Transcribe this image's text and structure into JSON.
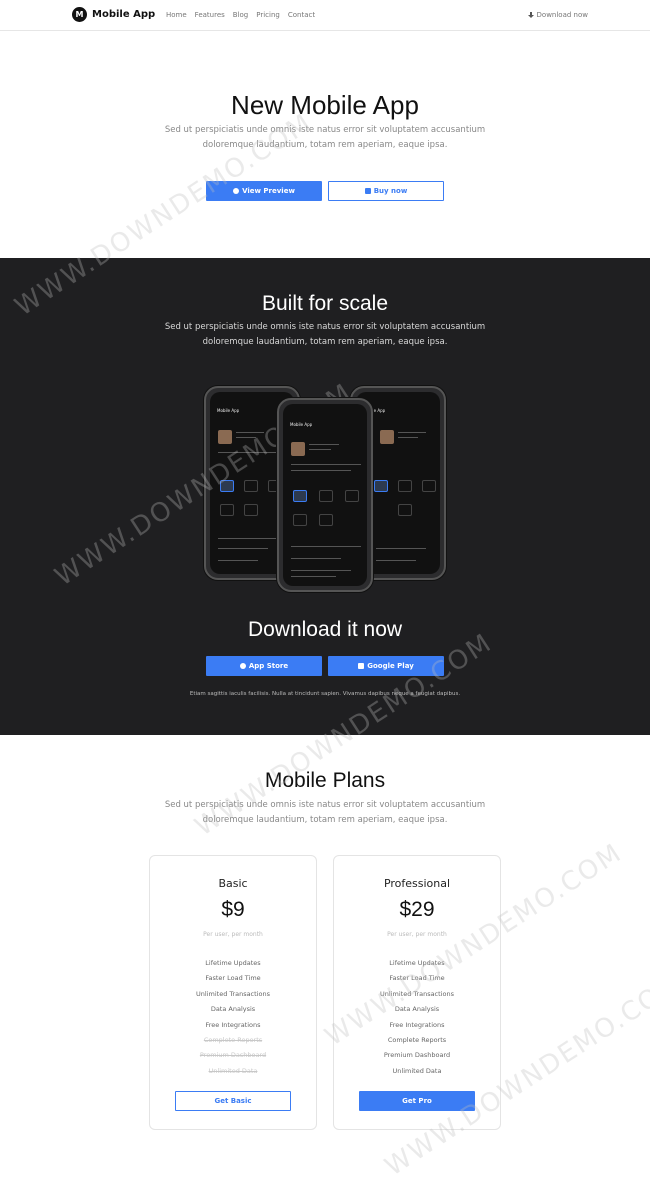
{
  "nav": {
    "logo_letter": "M",
    "brand": "Mobile App",
    "menu": [
      "Home",
      "Features",
      "Blog",
      "Pricing",
      "Contact"
    ],
    "download_label": "Download now"
  },
  "hero": {
    "title": "New Mobile App",
    "text": "Sed ut perspiciatis unde omnis iste natus error sit voluptatem accusantium doloremque laudantium, totam rem aperiam, eaque ipsa.",
    "preview_label": "View Preview",
    "buy_label": "Buy now"
  },
  "scale": {
    "title": "Built for scale",
    "text": "Sed ut perspiciatis unde omnis iste natus error sit voluptatem accusantium doloremque laudantium, totam rem aperiam, eaque ipsa.",
    "phones": [
      {
        "app_title": "Mobile App"
      },
      {
        "app_title": "Mobile App"
      },
      {
        "app_title": "Mobile App"
      }
    ]
  },
  "download": {
    "title": "Download it now",
    "app_store_label": "App Store",
    "google_play_label": "Google Play",
    "note": "Etiam sagittis iaculis facilisis. Nulla at tincidunt sapien. Vivamus dapibus neque a feugiat dapibus."
  },
  "plans": {
    "title": "Mobile Plans",
    "text": "Sed ut perspiciatis unde omnis iste natus error sit voluptatem accusantium doloremque laudantium, totam rem aperiam, eaque ipsa.",
    "items": [
      {
        "name": "Basic",
        "price": "$9",
        "per": "Per user, per month",
        "features": [
          "Lifetime Updates",
          "Faster Load Time",
          "Unlimited Transactions",
          "Data Analysis",
          "Free Integrations"
        ],
        "disabled_features": [
          "Complete Reports",
          "Premium Dashboard",
          "Unlimited Data"
        ],
        "button_label": "Get Basic"
      },
      {
        "name": "Professional",
        "price": "$29",
        "per": "Per user, per month",
        "features": [
          "Lifetime Updates",
          "Faster Load Time",
          "Unlimited Transactions",
          "Data Analysis",
          "Free Integrations",
          "Complete Reports",
          "Premium Dashboard",
          "Unlimited Data"
        ],
        "disabled_features": [],
        "button_label": "Get Pro"
      }
    ]
  },
  "watermark": "WWW.DOWNDEMO.COM",
  "colors": {
    "accent": "#3b7cf4",
    "dark_section": "#1f1f21"
  },
  "icons": [
    "download-icon",
    "play-circle-icon",
    "shopping-bag-icon",
    "apple-icon",
    "google-play-icon"
  ]
}
